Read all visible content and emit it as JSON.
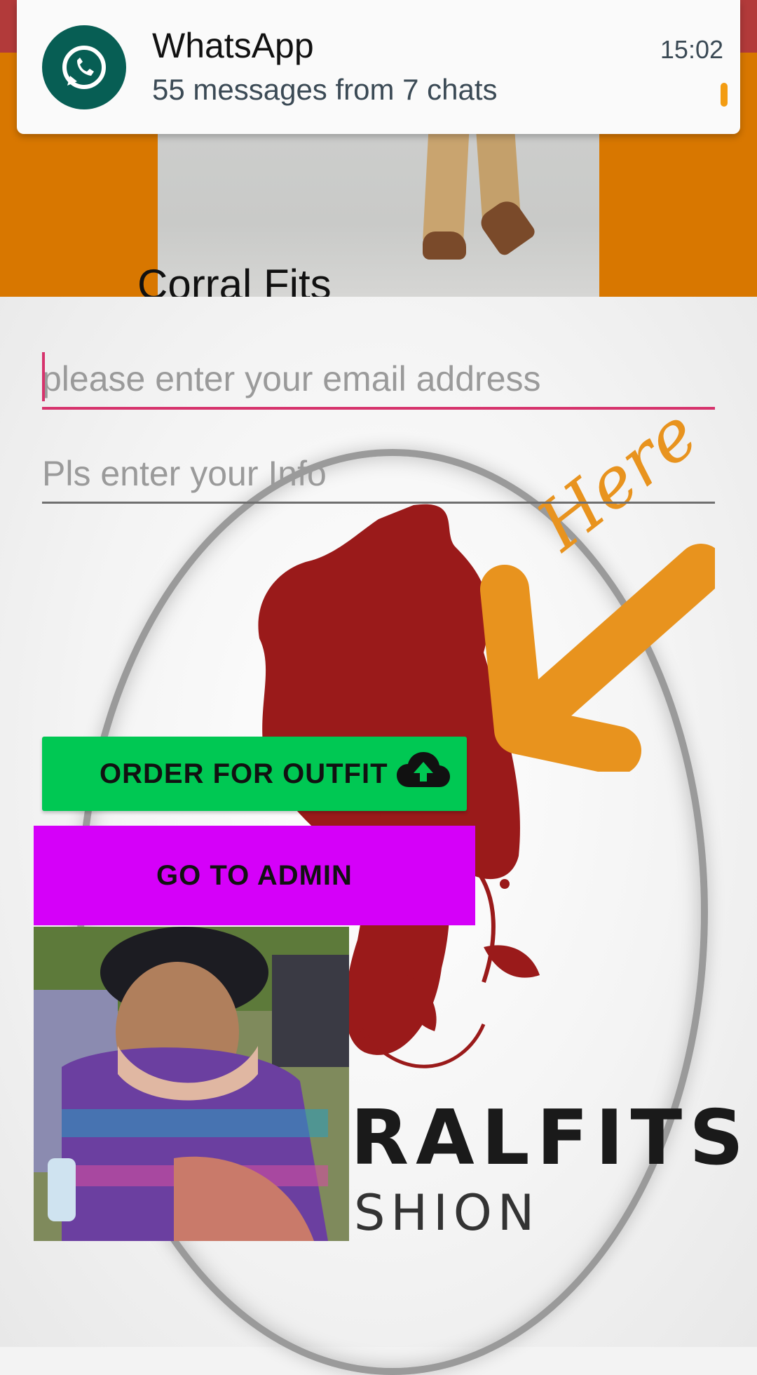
{
  "notification": {
    "app": "WhatsApp",
    "message": "55 messages from 7 chats",
    "time": "15:02",
    "icon": "whatsapp-icon"
  },
  "header": {
    "title": "Corral Fits",
    "background_color": "#d87700"
  },
  "form": {
    "email_placeholder": "please enter your email address",
    "email_value": "",
    "info_placeholder": "Pls enter your Info",
    "info_value": ""
  },
  "buttons": {
    "order_label": "ORDER FOR OUTFIT",
    "order_icon": "cloud-upload-icon",
    "order_color": "#00c853",
    "admin_label": "GO TO ADMIN",
    "admin_color": "#d500f9"
  },
  "background_logo": {
    "text": "RALFITS",
    "subtext": "SHION"
  },
  "annotation": {
    "text": "Here",
    "color": "#e8931e"
  }
}
